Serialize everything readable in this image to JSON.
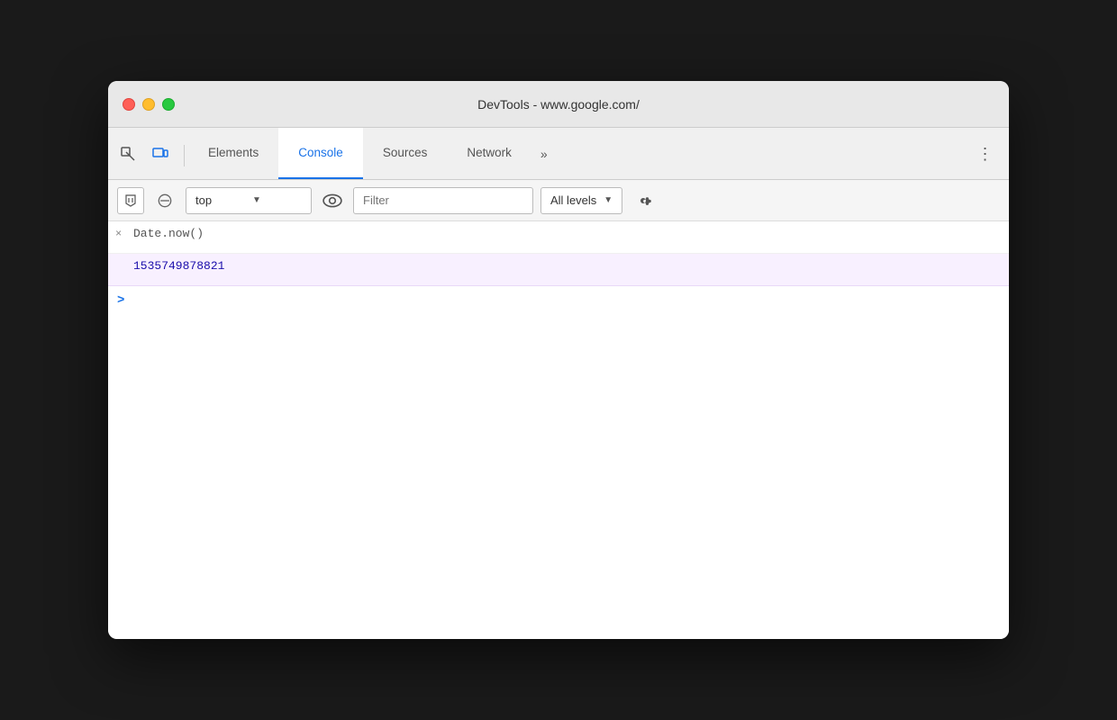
{
  "window": {
    "title": "DevTools - www.google.com/"
  },
  "trafficLights": {
    "close": "close",
    "minimize": "minimize",
    "maximize": "maximize"
  },
  "tabs": [
    {
      "id": "elements",
      "label": "Elements",
      "active": false
    },
    {
      "id": "console",
      "label": "Console",
      "active": true
    },
    {
      "id": "sources",
      "label": "Sources",
      "active": false
    },
    {
      "id": "network",
      "label": "Network",
      "active": false
    }
  ],
  "tabMore": "»",
  "kebab": "⋮",
  "toolbar": {
    "contextLabel": "top",
    "filterPlaceholder": "Filter",
    "levelsLabel": "All levels"
  },
  "console": {
    "entries": [
      {
        "id": "entry-1",
        "type": "input",
        "icon": "×",
        "text": "Date.now()"
      },
      {
        "id": "entry-2",
        "type": "result",
        "text": "1535749878821"
      }
    ],
    "promptSymbol": ">",
    "inputValue": ""
  }
}
